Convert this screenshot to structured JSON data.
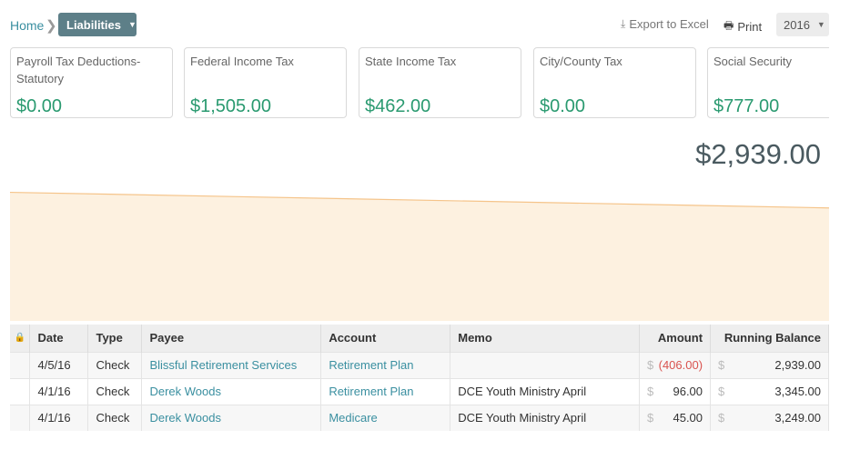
{
  "breadcrumb": {
    "home": "Home",
    "separator": "❯",
    "current": "Liabilities",
    "caret": "▼"
  },
  "actions": {
    "export_label": "Export to Excel",
    "export_icon": "⤓",
    "print_label": "Print",
    "print_icon": "🖶"
  },
  "year": {
    "value": "2016",
    "caret": "▼"
  },
  "cards": [
    {
      "label": "Payroll Tax Deductions-Statutory",
      "value": "$0.00"
    },
    {
      "label": "Federal Income Tax",
      "value": "$1,505.00"
    },
    {
      "label": "State Income Tax",
      "value": "$462.00"
    },
    {
      "label": "City/County Tax",
      "value": "$0.00"
    },
    {
      "label": "Social Security",
      "value": "$777.00"
    }
  ],
  "total": "$2,939.00",
  "chart_data": {
    "type": "area",
    "series": [
      {
        "values": [
          3345,
          2939
        ]
      }
    ],
    "colors": {
      "fill": "#fdf1e0",
      "line": "#f5c48a"
    }
  },
  "table": {
    "columns": [
      "",
      "Date",
      "Type",
      "Payee",
      "Account",
      "Memo",
      "Amount",
      "Running Balance"
    ],
    "lock_icon": "🔒",
    "currency": "$",
    "rows": [
      {
        "date": "4/5/16",
        "type": "Check",
        "payee": "Blissful Retirement Services",
        "account": "Retirement Plan",
        "memo": "",
        "amount": "(406.00)",
        "balance": "2,939.00"
      },
      {
        "date": "4/1/16",
        "type": "Check",
        "payee": "Derek Woods",
        "account": "Retirement Plan",
        "memo": "DCE Youth Ministry April",
        "amount": "96.00",
        "balance": "3,345.00"
      },
      {
        "date": "4/1/16",
        "type": "Check",
        "payee": "Derek Woods",
        "account": "Medicare",
        "memo": "DCE Youth Ministry April",
        "amount": "45.00",
        "balance": "3,249.00"
      }
    ]
  }
}
